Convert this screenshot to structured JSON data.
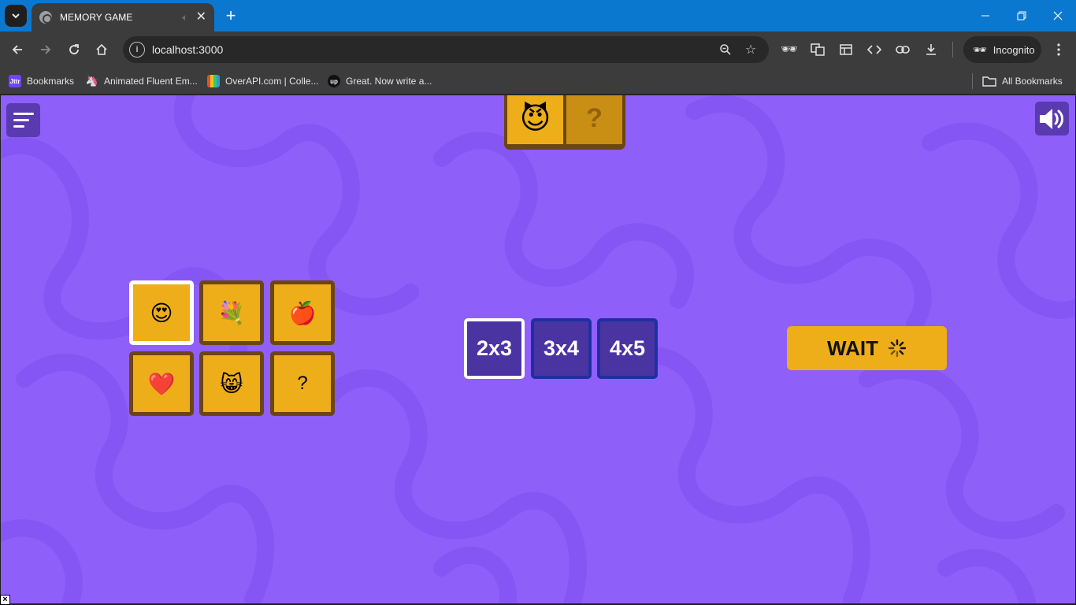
{
  "browser": {
    "tab_title": "MEMORY GAME",
    "url": "localhost:3000",
    "profile_label": "Incognito",
    "bookmarks": [
      {
        "label": "Bookmarks",
        "icon": "jttr",
        "color": "#6e44ff"
      },
      {
        "label": "Animated Fluent Em...",
        "icon": "unicorn-icon",
        "color": "#3c3c3c"
      },
      {
        "label": "OverAPI.com | Colle...",
        "icon": "overapi-icon",
        "color": "#3c3c3c"
      },
      {
        "label": "Great. Now write a...",
        "icon": "up",
        "color": "#111111"
      }
    ],
    "all_bookmarks_label": "All Bookmarks"
  },
  "game": {
    "top_cards": [
      {
        "emoji": "😈",
        "revealed": true
      },
      {
        "emoji": "?",
        "revealed": false
      }
    ],
    "board": {
      "rows": 2,
      "cols": 3,
      "cards": [
        {
          "emoji": "😍",
          "selected": true
        },
        {
          "emoji": "💐",
          "selected": false
        },
        {
          "emoji": "🍎",
          "selected": false
        },
        {
          "emoji": "❤️",
          "selected": false
        },
        {
          "emoji": "😸",
          "selected": false
        },
        {
          "emoji": "?",
          "selected": false
        }
      ]
    },
    "sizes": [
      {
        "label": "2x3",
        "active": true
      },
      {
        "label": "3x4",
        "active": false
      },
      {
        "label": "4x5",
        "active": false
      }
    ],
    "wait_label": "WAIT",
    "colors": {
      "background": "#8f5ff9",
      "card": "#eeae1a",
      "card_border": "#6b4613",
      "button_purple": "#4a34a2"
    }
  }
}
